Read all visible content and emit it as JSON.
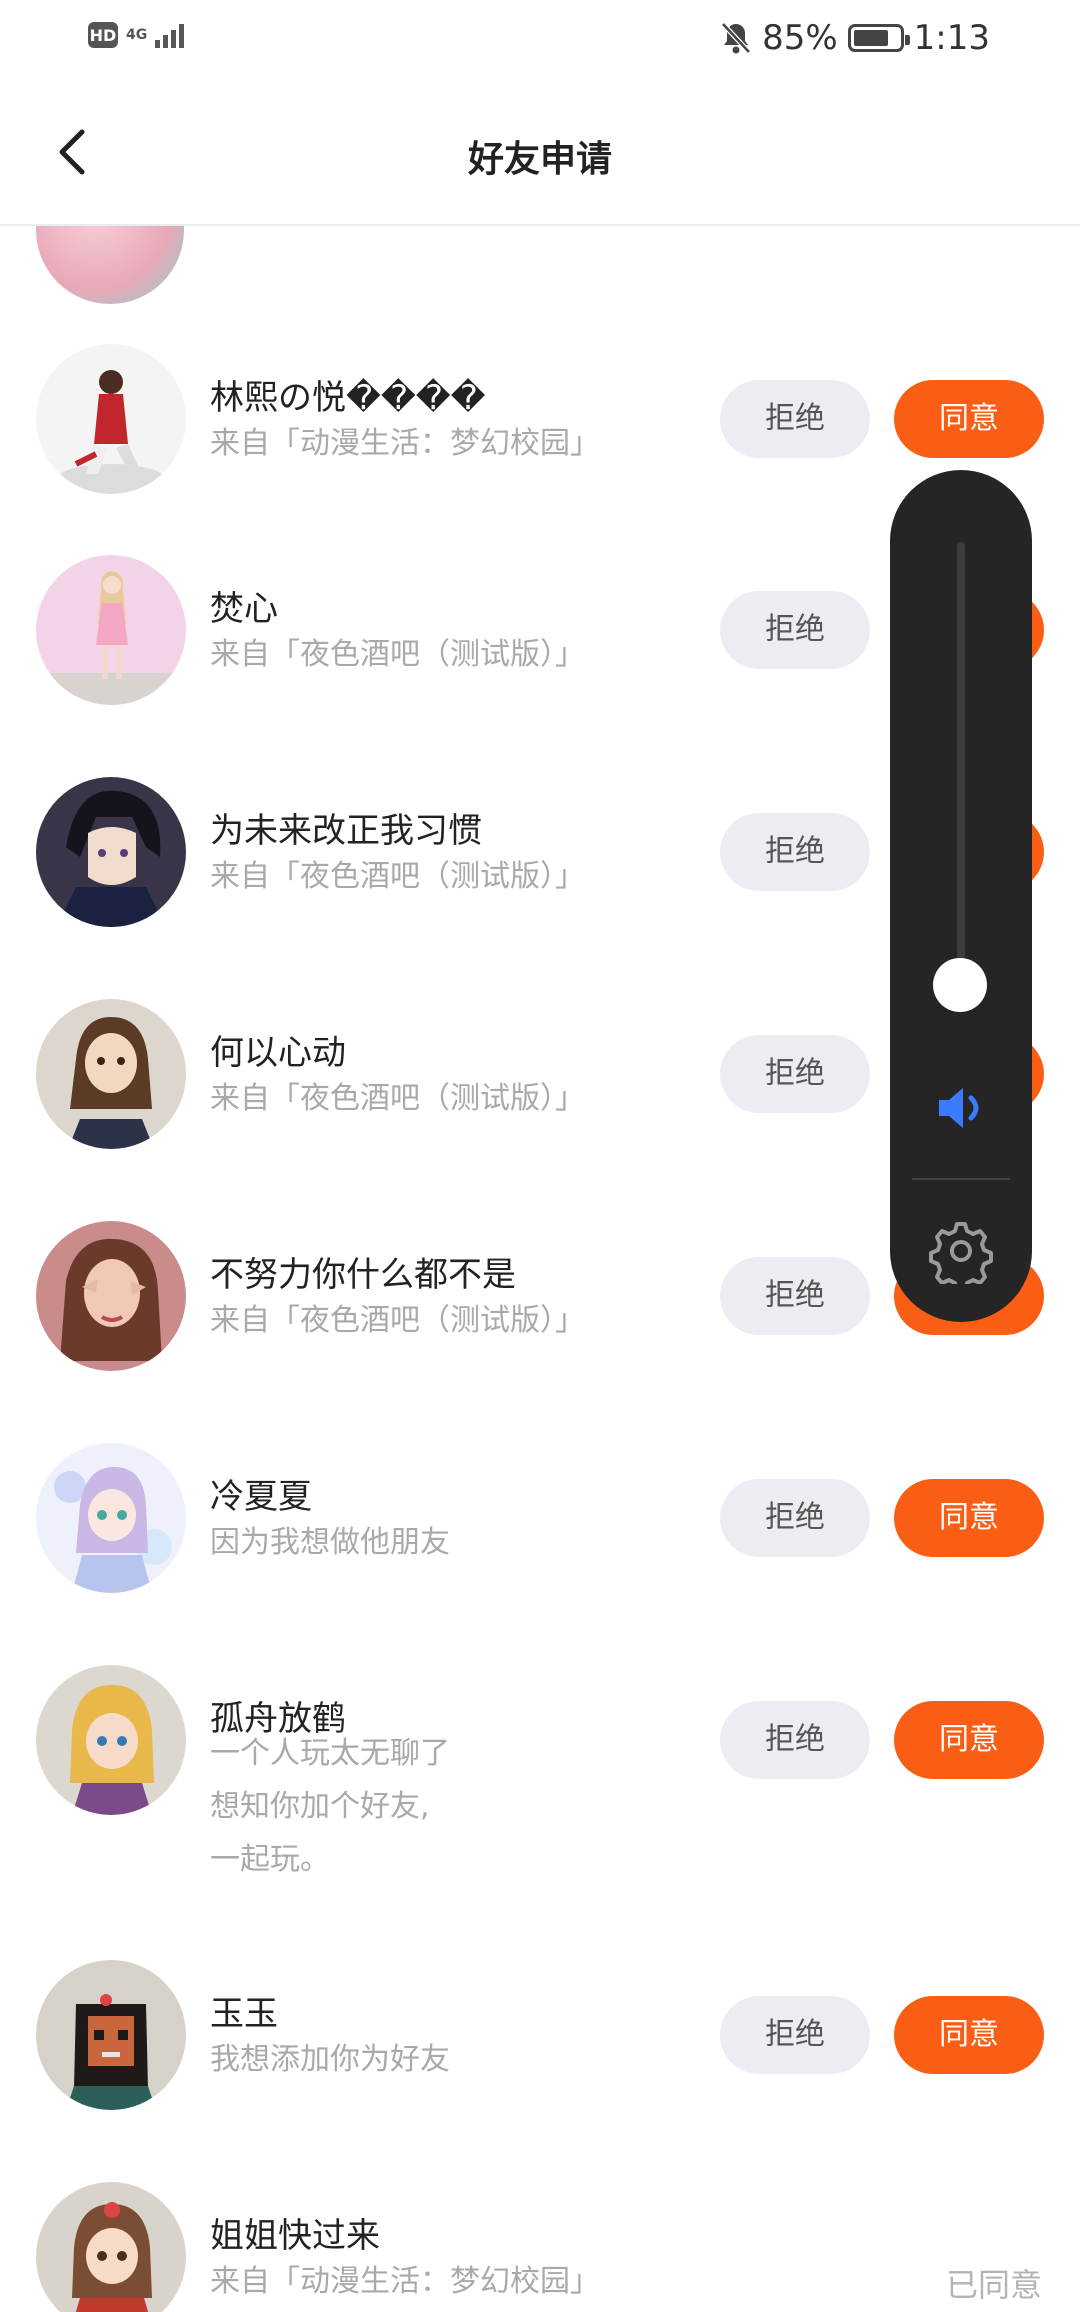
{
  "status_bar": {
    "hd_badge": "HD",
    "network": "4G",
    "battery_percent": "85%",
    "battery_level": 0.85,
    "time": "1:13",
    "icons": [
      "signal-icon",
      "mute-bell-icon",
      "battery-icon"
    ]
  },
  "header": {
    "title": "好友申请",
    "back_icon": "chevron-left-icon"
  },
  "buttons": {
    "reject": "拒绝",
    "accept": "同意",
    "accepted": "已同意"
  },
  "requests": [
    {
      "name": "林熙の悦����",
      "source": "来自「动漫生活：梦幻校园」",
      "status": "pending"
    },
    {
      "name": "焚心",
      "source": "来自「夜色酒吧（测试版）」",
      "status": "pending"
    },
    {
      "name": "为未来改正我习惯",
      "source": "来自「夜色酒吧（测试版）」",
      "status": "pending"
    },
    {
      "name": "何以心动",
      "source": "来自「夜色酒吧（测试版）」",
      "status": "pending"
    },
    {
      "name": "不努力你什么都不是",
      "source": "来自「夜色酒吧（测试版）」",
      "status": "pending"
    },
    {
      "name": "冷夏夏",
      "source": "因为我想做他朋友",
      "status": "pending"
    },
    {
      "name": "孤舟放鹤",
      "message_lines": [
        "一个人玩太无聊了",
        "想知你加个好友,",
        "一起玩。"
      ],
      "status": "pending"
    },
    {
      "name": "玉玉",
      "source": "我想添加你为好友",
      "status": "pending"
    },
    {
      "name": "姐姐快过来",
      "source": "来自「动漫生活：梦幻校园」",
      "status": "accepted"
    }
  ],
  "volume_panel": {
    "level": 0.05,
    "speaker_icon": "speaker-icon",
    "settings_icon": "gear-icon",
    "accent": "#3b7bff"
  },
  "colors": {
    "accent": "#fa5e15",
    "reject_bg": "#ebedf2",
    "muted_text": "#a9a9a9"
  }
}
